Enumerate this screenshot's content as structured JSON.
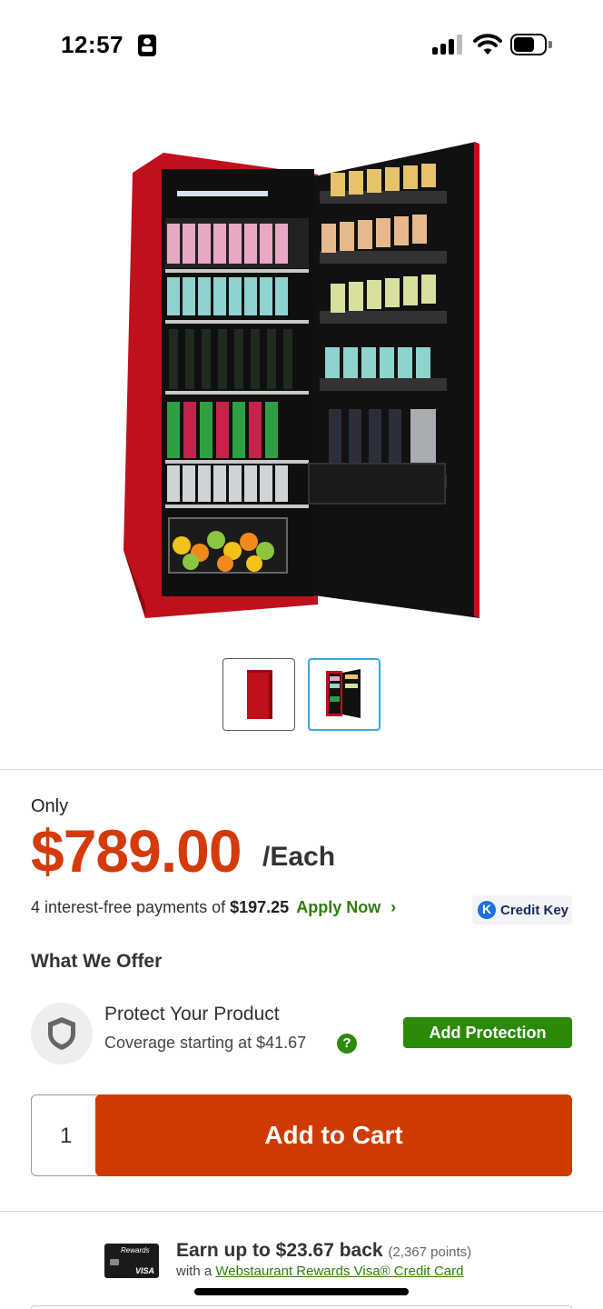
{
  "status_bar": {
    "time": "12:57"
  },
  "product": {
    "image_icon": "red-beverage-refrigerator-image",
    "thumbnails": [
      {
        "icon": "refrigerator-closed-thumbnail",
        "selected": false
      },
      {
        "icon": "refrigerator-open-thumbnail",
        "selected": true
      }
    ]
  },
  "pricing": {
    "only_label": "Only",
    "price": "$789.00",
    "unit": "/Each",
    "payments_prefix": "4 interest-free payments of",
    "payment_amount": "$197.25",
    "apply_now": "Apply Now",
    "credit_key_label": "Credit Key"
  },
  "offers": {
    "heading": "What We Offer",
    "protect_title": "Protect Your Product",
    "protect_subtitle": "Coverage starting at $41.67",
    "help_glyph": "?",
    "add_protection_label": "Add Protection"
  },
  "cart": {
    "quantity": "1",
    "add_to_cart_label": "Add to Cart"
  },
  "rewards": {
    "card_top_text": "Rewards",
    "card_visa_text": "VISA",
    "earn_text": "Earn up to $23.67 back",
    "points_text": "(2,367 points)",
    "with_prefix": "with a",
    "card_link": "Webstaurant Rewards Visa® Credit Card"
  },
  "colors": {
    "price": "#d43a0c",
    "add_to_cart": "#cf3a00",
    "protection_button": "#2b8a0a",
    "link_green": "#2e7d0c",
    "thumbnail_selected_border": "#36a9e1"
  }
}
